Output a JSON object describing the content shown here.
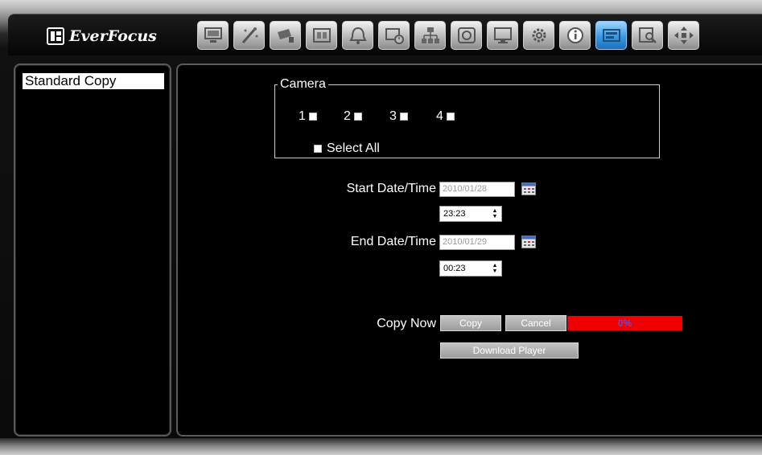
{
  "header": {
    "logo_text": "EverFocus",
    "toolbar": [
      {
        "icon": "monitor-icon",
        "active": false
      },
      {
        "icon": "wizard-icon",
        "active": false
      },
      {
        "icon": "camera-icon",
        "active": false
      },
      {
        "icon": "film-icon",
        "active": false
      },
      {
        "icon": "bell-icon",
        "active": false
      },
      {
        "icon": "schedule-icon",
        "active": false
      },
      {
        "icon": "network-icon",
        "active": false
      },
      {
        "icon": "disk-icon",
        "active": false
      },
      {
        "icon": "display-icon",
        "active": false
      },
      {
        "icon": "gear-icon",
        "active": false
      },
      {
        "icon": "info-icon",
        "active": false
      },
      {
        "icon": "backup-icon",
        "active": true
      },
      {
        "icon": "search-icon",
        "active": false
      },
      {
        "icon": "ptz-icon",
        "active": false
      }
    ]
  },
  "sidebar": {
    "items": [
      {
        "label": "Standard Copy",
        "selected": true
      }
    ]
  },
  "camera": {
    "legend": "Camera",
    "channels": [
      "1",
      "2",
      "3",
      "4"
    ],
    "select_all_label": "Select All"
  },
  "start": {
    "label": "Start Date/Time",
    "date": "2010/01/28",
    "time": "23:23"
  },
  "end": {
    "label": "End Date/Time",
    "date": "2010/01/29",
    "time": "00:23"
  },
  "copy": {
    "label": "Copy Now",
    "copy_button": "Copy",
    "cancel_button": "Cancel",
    "progress_text": "0%",
    "progress_value": 0,
    "download_button": "Download Player"
  },
  "colors": {
    "progress": "#f00000",
    "progress_text": "#5a4fe0",
    "active_tool": "#3a98e0"
  }
}
